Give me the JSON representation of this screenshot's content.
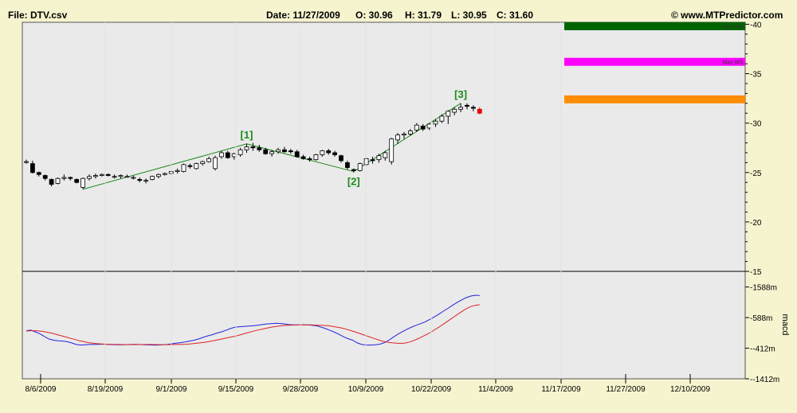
{
  "header": {
    "file": "File: DTV.csv",
    "date": "Date: 11/27/2009",
    "open": "O:  30.96",
    "high": "H:  31.79",
    "low": "L:  30.95",
    "close": "C:  31.60",
    "copyright": "© www.MTPredictor.com"
  },
  "chart_data": {
    "type": "candlestick",
    "price_axis": {
      "ticks": [
        "40",
        "35",
        "30",
        "25",
        "20",
        "15"
      ],
      "ylim": [
        15,
        40.2
      ]
    },
    "macd_axis": {
      "ticks": [
        "1588m",
        "588m",
        "-412m",
        "-1412m"
      ],
      "label": "macd",
      "ylim": [
        -1412,
        2100
      ]
    },
    "date_labels": [
      "8/6/2009",
      "8/19/2009",
      "9/1/2009",
      "9/15/2009",
      "9/28/2009",
      "10/9/2009",
      "10/22/2009",
      "11/4/2009",
      "11/17/2009",
      "11/27/2009",
      "12/10/2009"
    ],
    "target_bands": [
      {
        "label": "Ext. W5",
        "price": 39.8,
        "color": "#006400"
      },
      {
        "label": "Max W5",
        "price": 36.2,
        "color": "#ff00ff"
      },
      {
        "label": "",
        "price": 32.4,
        "color": "#ff8c00"
      }
    ],
    "wave_labels": [
      {
        "label": "[1]",
        "bar": 35,
        "price": 27.9,
        "pos": "above"
      },
      {
        "label": "[2]",
        "bar": 52,
        "price": 25.1,
        "pos": "below"
      },
      {
        "label": "[3]",
        "bar": 69,
        "price": 32.0,
        "pos": "above"
      }
    ],
    "wave_lines": [
      {
        "from": [
          9,
          23.3
        ],
        "to": [
          35,
          27.9
        ]
      },
      {
        "from": [
          35,
          27.9
        ],
        "to": [
          52,
          25.1
        ]
      },
      {
        "from": [
          52,
          25.1
        ],
        "to": [
          69,
          32.0
        ]
      }
    ],
    "candles": [
      [
        26.1,
        26.3,
        25.9,
        26.1
      ],
      [
        25.9,
        26.2,
        24.9,
        25.0
      ],
      [
        25.0,
        25.1,
        24.6,
        24.8
      ],
      [
        24.7,
        24.8,
        24.2,
        24.4
      ],
      [
        24.3,
        24.4,
        23.6,
        23.8
      ],
      [
        23.9,
        24.5,
        23.8,
        24.4
      ],
      [
        24.4,
        24.8,
        24.2,
        24.5
      ],
      [
        24.5,
        24.6,
        24.2,
        24.4
      ],
      [
        24.3,
        24.4,
        23.9,
        24.0
      ],
      [
        23.5,
        24.5,
        23.3,
        24.4
      ],
      [
        24.4,
        24.8,
        24.2,
        24.6
      ],
      [
        24.6,
        24.9,
        24.4,
        24.7
      ],
      [
        24.7,
        24.9,
        24.6,
        24.8
      ],
      [
        24.8,
        24.9,
        24.6,
        24.7
      ],
      [
        24.6,
        24.8,
        24.4,
        24.6
      ],
      [
        24.6,
        24.8,
        24.4,
        24.7
      ],
      [
        24.6,
        24.8,
        24.5,
        24.6
      ],
      [
        24.5,
        24.7,
        24.3,
        24.5
      ],
      [
        24.3,
        24.5,
        24.0,
        24.2
      ],
      [
        24.2,
        24.4,
        23.9,
        24.2
      ],
      [
        24.3,
        24.7,
        24.2,
        24.6
      ],
      [
        24.6,
        24.9,
        24.4,
        24.8
      ],
      [
        24.8,
        25.0,
        24.7,
        24.9
      ],
      [
        24.9,
        25.2,
        24.8,
        25.1
      ],
      [
        25.1,
        25.4,
        24.9,
        25.2
      ],
      [
        25.1,
        25.9,
        25.0,
        25.8
      ],
      [
        25.7,
        25.9,
        25.4,
        25.6
      ],
      [
        25.4,
        26.0,
        25.3,
        25.9
      ],
      [
        25.9,
        26.2,
        25.7,
        26.1
      ],
      [
        26.1,
        26.6,
        26.0,
        26.4
      ],
      [
        25.4,
        26.7,
        25.2,
        26.5
      ],
      [
        26.6,
        27.2,
        26.4,
        27.0
      ],
      [
        27.0,
        27.2,
        26.4,
        26.5
      ],
      [
        26.6,
        27.0,
        26.3,
        26.9
      ],
      [
        26.8,
        27.5,
        26.6,
        27.3
      ],
      [
        27.3,
        27.9,
        27.0,
        27.6
      ],
      [
        27.6,
        28.0,
        27.2,
        27.5
      ],
      [
        27.5,
        27.8,
        27.1,
        27.3
      ],
      [
        27.3,
        27.5,
        26.8,
        26.9
      ],
      [
        26.9,
        27.3,
        26.6,
        27.1
      ],
      [
        27.1,
        27.5,
        26.9,
        27.3
      ],
      [
        27.3,
        27.6,
        27.0,
        27.1
      ],
      [
        27.2,
        27.4,
        26.9,
        27.1
      ],
      [
        27.1,
        27.3,
        26.5,
        26.6
      ],
      [
        26.6,
        26.8,
        26.3,
        26.4
      ],
      [
        26.4,
        26.6,
        26.1,
        26.3
      ],
      [
        26.3,
        26.9,
        26.2,
        26.8
      ],
      [
        26.8,
        27.3,
        26.6,
        27.2
      ],
      [
        27.2,
        27.4,
        26.8,
        27.0
      ],
      [
        27.0,
        27.2,
        26.6,
        26.8
      ],
      [
        26.7,
        26.8,
        26.0,
        26.2
      ],
      [
        26.0,
        26.2,
        25.3,
        25.5
      ],
      [
        25.3,
        25.4,
        25.0,
        25.2
      ],
      [
        25.2,
        26.0,
        25.1,
        25.9
      ],
      [
        25.8,
        26.5,
        25.7,
        26.4
      ],
      [
        26.3,
        26.6,
        25.9,
        26.2
      ],
      [
        26.3,
        26.9,
        26.0,
        26.7
      ],
      [
        26.5,
        27.2,
        26.2,
        27.0
      ],
      [
        26.1,
        28.5,
        25.8,
        28.4
      ],
      [
        28.3,
        29.0,
        27.9,
        28.8
      ],
      [
        28.8,
        29.1,
        28.4,
        28.9
      ],
      [
        28.9,
        29.4,
        28.7,
        29.2
      ],
      [
        29.3,
        30.0,
        29.1,
        29.8
      ],
      [
        29.7,
        29.9,
        29.2,
        29.4
      ],
      [
        29.5,
        30.0,
        29.3,
        29.9
      ],
      [
        29.9,
        30.4,
        29.6,
        30.2
      ],
      [
        30.2,
        30.9,
        30.0,
        30.7
      ],
      [
        30.7,
        31.3,
        29.9,
        31.2
      ],
      [
        31.1,
        31.6,
        30.8,
        31.4
      ],
      [
        31.4,
        32.0,
        31.1,
        31.6
      ],
      [
        31.8,
        32.0,
        31.4,
        31.7
      ],
      [
        31.6,
        31.8,
        31.2,
        31.5
      ],
      [
        31.4,
        31.6,
        30.9,
        31.0
      ]
    ],
    "macd_series": [
      {
        "color": "#2222dd",
        "values": [
          160,
          180,
          120,
          60,
          -30,
          -110,
          -150,
          -170,
          -180,
          -200,
          -240,
          -290,
          -310,
          -300,
          -290,
          -290,
          -285,
          -280,
          -290,
          -295,
          -300,
          -300,
          -295,
          -290,
          -285,
          -290,
          -300,
          -305,
          -310,
          -310,
          -300,
          -290,
          -270,
          -250,
          -230,
          -210,
          -180,
          -150,
          -110,
          -60,
          -10,
          30,
          80,
          120,
          170,
          230,
          270,
          290,
          300,
          310,
          320,
          340,
          360,
          380,
          390,
          400,
          395,
          380,
          360,
          350,
          350,
          355,
          350,
          340,
          320,
          280,
          230,
          170,
          110,
          40,
          -40,
          -100,
          -150,
          -240,
          -290,
          -310,
          -310,
          -300,
          -280,
          -230,
          -150,
          -50,
          50,
          130,
          210,
          280,
          340,
          390,
          450,
          530,
          610,
          700,
          800,
          890,
          990,
          1080,
          1160,
          1240,
          1290,
          1320,
          1310
        ]
      },
      {
        "color": "#dd2222",
        "values": [
          150,
          160,
          160,
          150,
          130,
          100,
          70,
          30,
          -10,
          -50,
          -90,
          -130,
          -170,
          -200,
          -230,
          -250,
          -265,
          -275,
          -282,
          -287,
          -290,
          -292,
          -294,
          -295,
          -295,
          -294,
          -293,
          -292,
          -292,
          -293,
          -295,
          -296,
          -296,
          -294,
          -292,
          -288,
          -282,
          -270,
          -255,
          -240,
          -220,
          -200,
          -170,
          -140,
          -110,
          -80,
          -50,
          -20,
          20,
          60,
          100,
          140,
          180,
          210,
          240,
          270,
          295,
          315,
          330,
          340,
          345,
          348,
          350,
          350,
          348,
          345,
          340,
          330,
          320,
          300,
          275,
          245,
          210,
          165,
          120,
          70,
          20,
          -30,
          -80,
          -130,
          -180,
          -210,
          -230,
          -245,
          -255,
          -250,
          -220,
          -170,
          -110,
          -40,
          30,
          110,
          200,
          290,
          390,
          490,
          590,
          690,
          790,
          880,
          950,
          990,
          1010
        ]
      }
    ]
  }
}
